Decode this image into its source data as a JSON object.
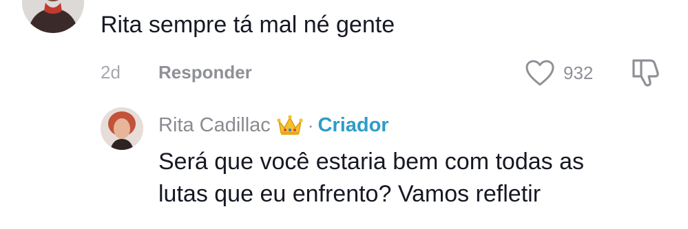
{
  "comment": {
    "text": "Rita sempre tá mal né gente",
    "time": "2d",
    "reply_label": "Responder",
    "like_count": "932"
  },
  "reply": {
    "author": "Rita Cadillac",
    "separator": "·",
    "creator_label": "Criador",
    "text_line1": "Será que você estaria bem com todas as",
    "text_line2": "lutas que eu enfrento? Vamos refletir"
  },
  "icons": {
    "like": "heart-outline-icon",
    "dislike": "thumbs-down-icon",
    "badge": "crown-emoji-icon"
  },
  "colors": {
    "creator_accent": "#2f9cc8",
    "text_primary": "#161823",
    "text_muted": "#8f9096"
  }
}
